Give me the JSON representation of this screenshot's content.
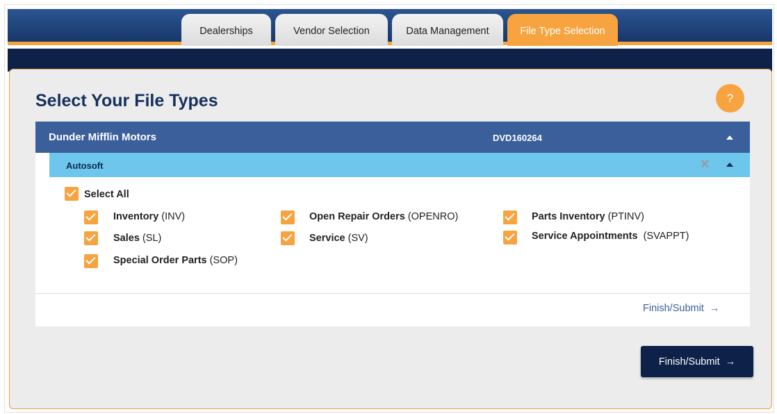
{
  "tabs": [
    {
      "label": "Dealerships",
      "active": false
    },
    {
      "label": "Vendor Selection",
      "active": false
    },
    {
      "label": "Data Management",
      "active": false
    },
    {
      "label": "File Type Selection",
      "active": true
    }
  ],
  "page": {
    "title": "Select Your File Types",
    "help_label": "?"
  },
  "dealer": {
    "name": "Dunder Mifflin Motors",
    "code": "DVD160264"
  },
  "vendor": {
    "name": "Autosoft",
    "close_glyph": "✕"
  },
  "select_all": {
    "label": "Select All",
    "checked": true
  },
  "file_types": [
    {
      "name": "Inventory",
      "code": "(INV)",
      "checked": true
    },
    {
      "name": "Open Repair Orders",
      "code": "(OPENRO)",
      "checked": true
    },
    {
      "name": "Parts Inventory",
      "code": "(PTINV)",
      "checked": true
    },
    {
      "name": "Sales",
      "code": "(SL)",
      "checked": true
    },
    {
      "name": "Service",
      "code": "(SV)",
      "checked": true
    },
    {
      "name": "Service Appointments",
      "code": "(SVAPPT)",
      "checked": true
    },
    {
      "name": "Special Order Parts",
      "code": "(SOP)",
      "checked": true
    }
  ],
  "actions": {
    "inline_submit": "Finish/Submit",
    "submit_button": "Finish/Submit",
    "arrow_glyph": "→"
  },
  "colors": {
    "navy": "#16305c",
    "accent_orange": "#f7a440",
    "vendor_blue": "#6ec6ec",
    "dealer_blue": "#3a5f9b"
  }
}
